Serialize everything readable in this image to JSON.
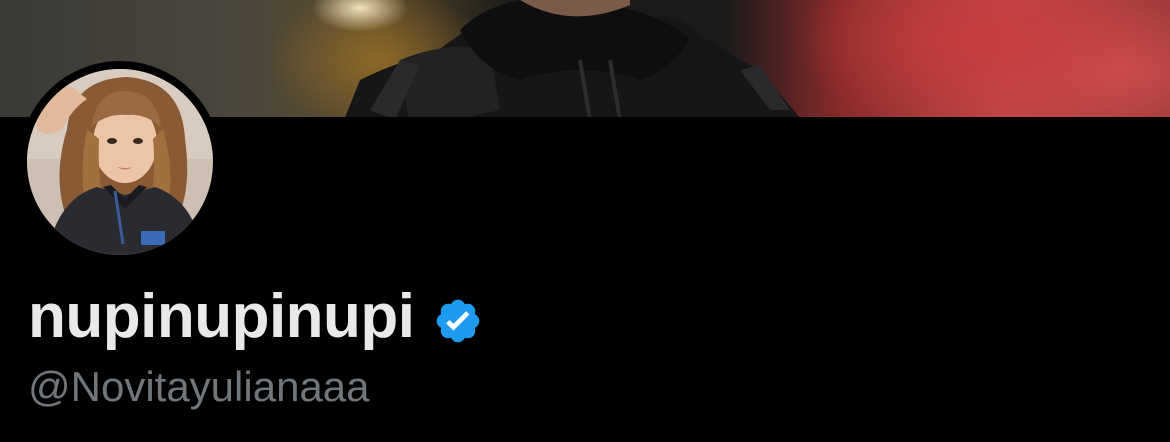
{
  "profile": {
    "display_name": "nupinupinupi",
    "handle": "@Novitayulianaaa",
    "verified_badge_color": "#1d9bf0",
    "verified": true
  },
  "banner": {
    "icon": "banner-photo"
  },
  "avatar": {
    "icon": "profile-photo"
  },
  "colors": {
    "background": "#000000",
    "name_text": "#e7e9ea",
    "handle_text": "#71767b",
    "accent": "#1d9bf0"
  }
}
